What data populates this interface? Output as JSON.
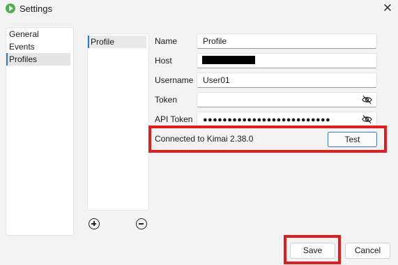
{
  "window": {
    "title": "Settings",
    "app_icon": "play-icon",
    "close_icon": "close-icon"
  },
  "categories": [
    {
      "label": "General",
      "selected": false
    },
    {
      "label": "Events",
      "selected": false
    },
    {
      "label": "Profiles",
      "selected": true
    }
  ],
  "profiles": {
    "items": [
      "Profile"
    ],
    "add_icon": "plus-circle-icon",
    "remove_icon": "minus-circle-icon"
  },
  "form": {
    "name_label": "Name",
    "name_value": "Profile",
    "host_label": "Host",
    "host_value": "",
    "username_label": "Username",
    "username_value": "User01",
    "token_label": "Token",
    "token_value": "",
    "api_token_label": "API Token",
    "api_token_value": "●●●●●●●●●●●●●●●●●●●●●●●●●●",
    "visibility_icon": "eye-off-icon"
  },
  "connection": {
    "status": "Connected to Kimai 2.38.0",
    "test_label": "Test"
  },
  "footer": {
    "save_label": "Save",
    "cancel_label": "Cancel"
  },
  "colors": {
    "accent": "#2a79d7",
    "highlight": "#e01e1e",
    "background": "#f3f3f3"
  }
}
